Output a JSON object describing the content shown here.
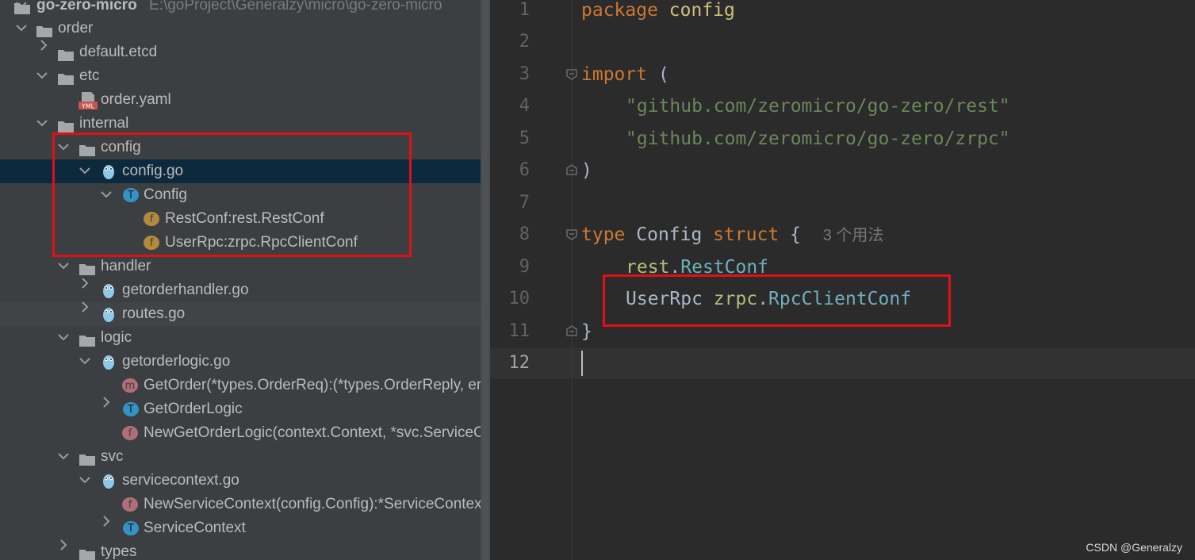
{
  "project": {
    "name": "go-zero-micro",
    "path": "E:\\goProject\\Generalzy\\micro\\go-zero-micro"
  },
  "tree": [
    {
      "label": "order"
    },
    {
      "label": "default.etcd"
    },
    {
      "label": "etc"
    },
    {
      "label": "order.yaml"
    },
    {
      "label": "internal"
    },
    {
      "label": "config"
    },
    {
      "label": "config.go"
    },
    {
      "label": "Config"
    },
    {
      "label": "RestConf:rest.RestConf"
    },
    {
      "label": "UserRpc:zrpc.RpcClientConf"
    },
    {
      "label": "handler"
    },
    {
      "label": "getorderhandler.go"
    },
    {
      "label": "routes.go"
    },
    {
      "label": "logic"
    },
    {
      "label": "getorderlogic.go"
    },
    {
      "label": "GetOrder(*types.OrderReq):(*types.OrderReply, err"
    },
    {
      "label": "GetOrderLogic"
    },
    {
      "label": "NewGetOrderLogic(context.Context, *svc.ServiceCo"
    },
    {
      "label": "svc"
    },
    {
      "label": "servicecontext.go"
    },
    {
      "label": "NewServiceContext(config.Config):*ServiceContext"
    },
    {
      "label": "ServiceContext"
    },
    {
      "label": "types"
    }
  ],
  "editor": {
    "line_numbers": [
      "1",
      "2",
      "3",
      "4",
      "5",
      "6",
      "7",
      "8",
      "9",
      "10",
      "11",
      "12"
    ],
    "current_line": "12",
    "code": {
      "l1_kw": "package",
      "l1_name": "config",
      "l3_kw": "import",
      "l3_paren": "(",
      "l4_str": "\"github.com/zeromicro/go-zero/rest\"",
      "l5_str": "\"github.com/zeromicro/go-zero/zrpc\"",
      "l6_paren": ")",
      "l8_kw": "type",
      "l8_name": "Config",
      "l8_kw2": "struct",
      "l8_brace": "{",
      "l8_usage": "3 个用法",
      "l9_pkg": "rest",
      "l9_dot": ".",
      "l9_type": "RestConf",
      "l10_field": "UserRpc",
      "l10_pkg": "zrpc",
      "l10_dot": ".",
      "l10_type": "RpcClientConf",
      "l11_brace": "}"
    }
  },
  "file_icon_text": "YML",
  "icon_letters": {
    "type": "T",
    "field": "f",
    "method": "m",
    "func": "f"
  },
  "watermark": "CSDN @Generalzy",
  "colors": {
    "highlight_box": "#e0101a",
    "selection": "#0d293e",
    "keyword": "#cc7832",
    "string": "#6a8759"
  }
}
